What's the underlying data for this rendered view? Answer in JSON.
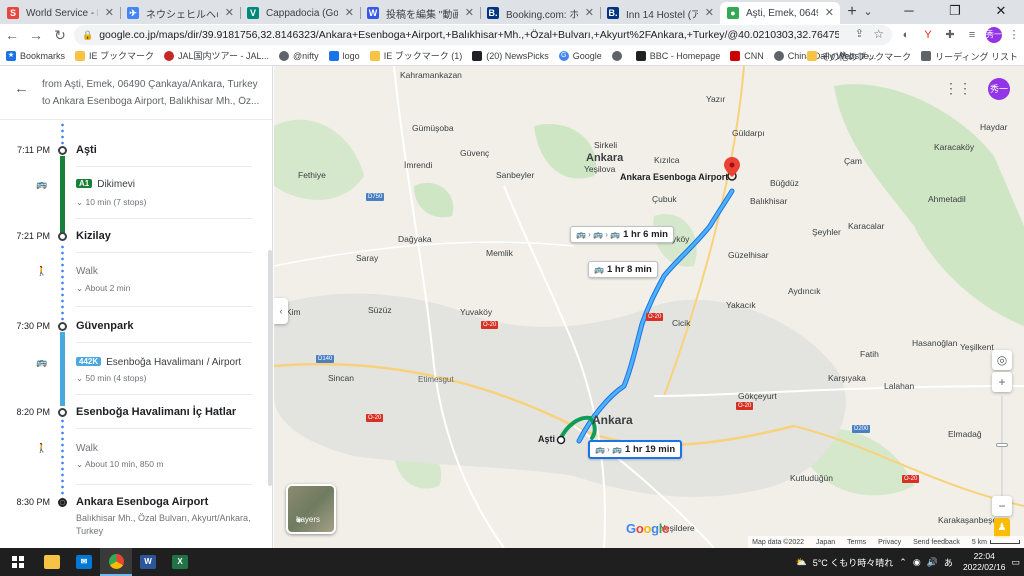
{
  "browser": {
    "tabs": [
      {
        "title": "World Service - Listen",
        "favicon": "S",
        "color": "#e8453c"
      },
      {
        "title": "ネウシェヒルへの片道便",
        "favicon": "✈",
        "color": "#4285f4"
      },
      {
        "title": "Cappadocia (Goreme",
        "favicon": "V",
        "color": "#00897b"
      },
      {
        "title": "投稿を編集 \"動画で見",
        "favicon": "W",
        "color": "#3858e9"
      },
      {
        "title": "Booking.com: ホテル",
        "favicon": "B.",
        "color": "#003580"
      },
      {
        "title": "Inn 14 Hostel (アンカラ",
        "favicon": "B.",
        "color": "#003580"
      },
      {
        "title": "Aşti, Emek, 06490 Çan",
        "favicon": "●",
        "color": "#34a853"
      }
    ],
    "url": "google.co.jp/maps/dir/39.9181756,32.8146323/Ankara+Esenboga+Airport,+Balıkhisar+Mh.,+Özal+Bulvarı,+Akyurt%2FAnkara,+Turkey/@40.0210303,32.7647592,11z/am=t/...",
    "profile_initial": "秀一",
    "bookmarks": [
      "Bookmarks",
      "IE ブックマーク",
      "JAL国内ツアー - JAL...",
      "@nifty",
      "logo",
      "IE ブックマーク (1)",
      "(20) NewsPicks",
      "Google",
      "",
      "BBC - Homepage",
      "CNN",
      "China Daily Website..."
    ],
    "bookmarks_more": "»",
    "other_bookmarks": "その他のブックマーク",
    "reading_list": "リーディング リスト"
  },
  "panel": {
    "from": "from Aşti, Emek, 06490 Çankaya/Ankara, Turkey",
    "to": "to Ankara Esenboga Airport, Balıkhisar Mh., Öz...",
    "stops": [
      {
        "time": "7:11 PM",
        "name": "Aşti"
      },
      {
        "time": "7:21 PM",
        "name": "Kizilay"
      },
      {
        "time": "7:30 PM",
        "name": "Güvenpark"
      },
      {
        "time": "8:20 PM",
        "name": "Esenboğa Havalimanı İç Hatlar"
      },
      {
        "time": "8:30 PM",
        "name": "Ankara Esenboga Airport"
      }
    ],
    "legs": [
      {
        "badge": "A1",
        "badge_color": "#188038",
        "name": "Dikimevi",
        "detail": "10 min (7 stops)"
      },
      {
        "mode": "Walk",
        "detail": "About 2 min"
      },
      {
        "badge": "442K",
        "badge_color": "#4aa8e0",
        "name": "Esenboğa Havalimanı / Airport",
        "detail": "50 min (4 stops)"
      },
      {
        "mode": "Walk",
        "detail": "About 10 min, 850 m"
      }
    ],
    "destination_address": "Balıkhisar Mh., Özal Bulvarı, Akyurt/Ankara, Turkey"
  },
  "map": {
    "callouts": [
      {
        "text": "1 hr 6 min"
      },
      {
        "text": "1 hr 8 min"
      },
      {
        "text": "1 hr 19 min"
      }
    ],
    "origin_label": "Aşti",
    "destination_label": "Ankara Esenboga Airport",
    "city_label": "Ankara",
    "places": [
      "Kahramankazan",
      "Yazır",
      "Güldarpı",
      "Haydar",
      "Gümüşoba",
      "Güvenç",
      "Ankara",
      "Kızılca",
      "Karacaköy",
      "Fethiye",
      "İmrendi",
      "Sirkeli",
      "Yeşilova",
      "Çam",
      "Büğdüz",
      "Sanbeyler",
      "Çubuk",
      "Balıkhisar",
      "Ahmetadil",
      "Dağyaka",
      "Saray",
      "Şeyhler",
      "Karacalar",
      "Memlik",
      "Sarayköy",
      "Güzelhisar",
      "Yakacık",
      "Saray",
      "Aydıncık",
      "Süzüz",
      "Yuvaköy",
      "Cicik",
      "Gümüşoba",
      "Hasanoğlan",
      "Fatih",
      "Yeşilkent",
      "Sincan",
      "Karşıyaka",
      "Lalahan",
      "Gökçeyurt",
      "Elmadağ",
      "Kutludüğün",
      "Yeşildere",
      "Karakaşanbeşe",
      "Kim",
      "Etimesgut"
    ],
    "zoom_plus": "+",
    "zoom_minus": "−",
    "layers_label": "Layers",
    "logo": "Google",
    "footer": [
      "Map data ©2022",
      "Japan",
      "Terms",
      "Privacy",
      "Send feedback",
      "5 km"
    ]
  },
  "taskbar": {
    "weather": "5°C くもり時々晴れ",
    "ime": "あ",
    "time": "22:04",
    "date": "2022/02/16"
  }
}
